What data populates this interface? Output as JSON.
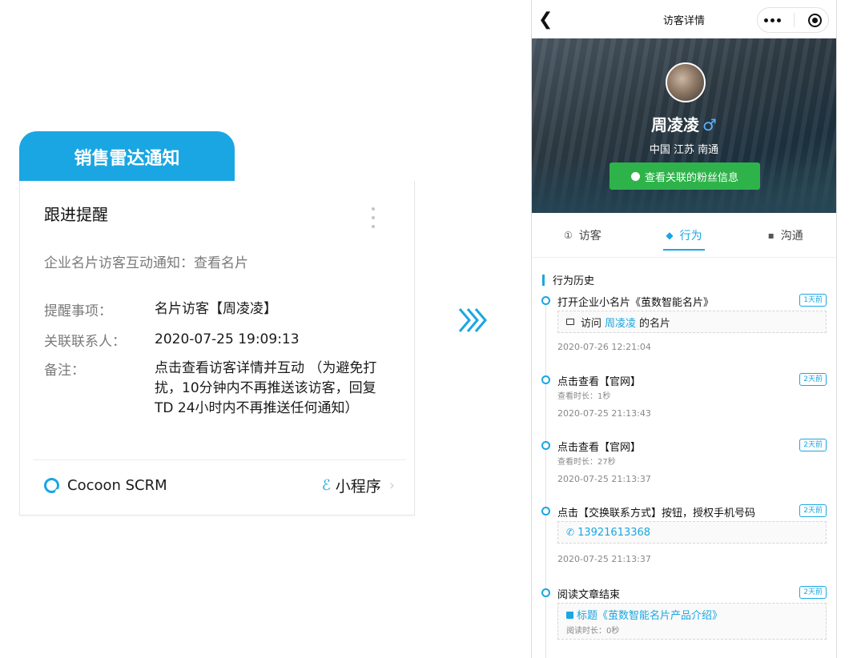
{
  "notification": {
    "tag": "销售雷达通知",
    "title": "跟进提醒",
    "subtitle": "企业名片访客互动通知：查看名片",
    "rows": [
      {
        "key": "提醒事项：",
        "value": "名片访客【周凌凌】"
      },
      {
        "key": "关联联系人：",
        "value": "2020-07-25 19:09:13"
      },
      {
        "key": "备注：",
        "value": "点击查看访客详情并互动 （为避免打扰，10分钟内不再推送该访客，回复TD 24小时内不再推送任何通知）"
      }
    ],
    "brand": "Cocoon SCRM",
    "mini_program": "小程序"
  },
  "phone": {
    "nav_title": "访客详情",
    "profile": {
      "name": "周凌凌",
      "gender_symbol": "♂",
      "location": "中国 江苏 南通",
      "fans_button": "查看关联的粉丝信息"
    },
    "tabs": [
      {
        "label": "访客",
        "icon": "①"
      },
      {
        "label": "行为",
        "icon": "◆"
      },
      {
        "label": "沟通",
        "icon": "▪"
      }
    ],
    "section_title": "行为历史",
    "events": [
      {
        "title": "打开企业小名片《茧数智能名片》",
        "badge": "1天前",
        "box_prefix": "访问",
        "box_highlight": "周凌凌",
        "box_suffix": "的名片",
        "time": "2020-07-26 12:21:04"
      },
      {
        "title": "点击查看【官网】",
        "badge": "2天前",
        "sub": "查看时长：1秒",
        "time": "2020-07-25 21:13:43"
      },
      {
        "title": "点击查看【官网】",
        "badge": "2天前",
        "sub": "查看时长：27秒",
        "time": "2020-07-25 21:13:37"
      },
      {
        "title": "点击【交换联系方式】按钮，授权手机号码",
        "badge": "2天前",
        "phone": "13921613368",
        "time": "2020-07-25 21:13:37"
      },
      {
        "title": "阅读文章结束",
        "badge": "2天前",
        "article": "标题《茧数智能名片产品介绍》",
        "read_time": "阅读时长：0秒"
      }
    ]
  }
}
